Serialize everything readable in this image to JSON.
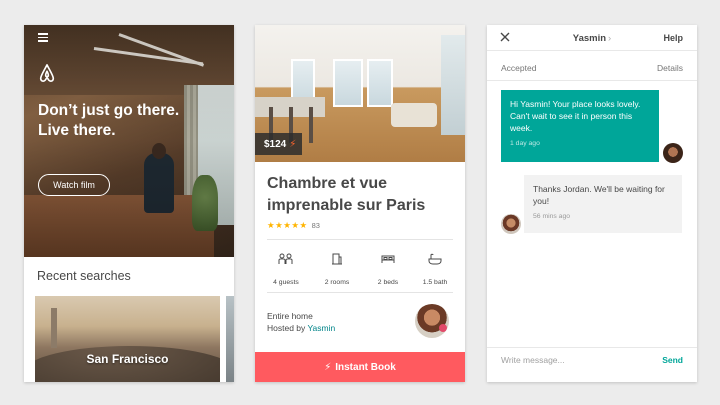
{
  "screen_home": {
    "hero_line1": "Don’t just go there.",
    "hero_line2": "Live there.",
    "watch_button": "Watch film",
    "recent_searches_title": "Recent searches",
    "recent_cities": [
      "San Francisco"
    ]
  },
  "screen_listing": {
    "price": "$124",
    "title": "Chambre et vue imprenable sur Paris",
    "stars": "★★★★★",
    "review_count": "83",
    "amenities": [
      {
        "icon": "guests-icon",
        "label": "4 guests"
      },
      {
        "icon": "rooms-icon",
        "label": "2 rooms"
      },
      {
        "icon": "beds-icon",
        "label": "2 beds"
      },
      {
        "icon": "bath-icon",
        "label": "1.5 bath"
      }
    ],
    "home_type": "Entire home",
    "hosted_by_prefix": "Hosted by",
    "host_name": "Yasmin",
    "book_button": "Instant Book",
    "accent": "#ff5a5f",
    "bolt_color": "#fc642d"
  },
  "screen_chat": {
    "contact_name": "Yasmin",
    "help": "Help",
    "status": "Accepted",
    "details": "Details",
    "messages": [
      {
        "text": "Hi Yasmin! Your place looks lovely. Can't wait to see it in person this week.",
        "time": "1 day ago"
      },
      {
        "text": "Thanks Jordan. We'll be waiting for you!",
        "time": "56 mins ago"
      }
    ],
    "compose_placeholder": "Write message...",
    "send": "Send",
    "accent": "#00a699"
  }
}
